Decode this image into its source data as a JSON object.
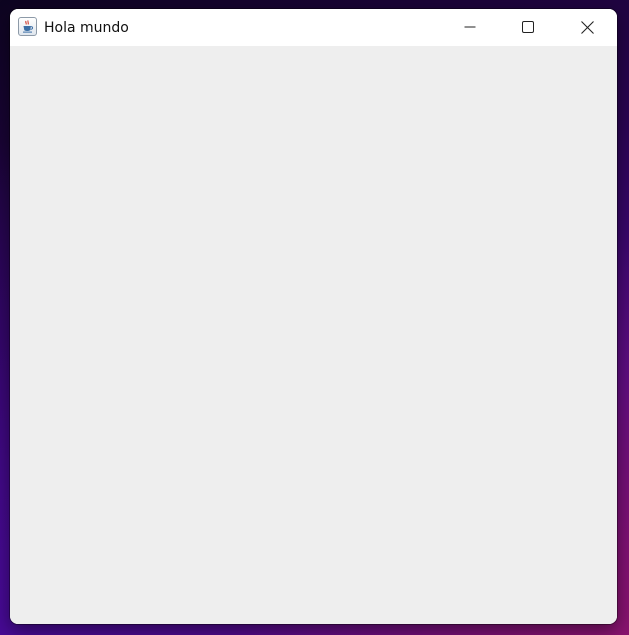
{
  "window": {
    "title": "Hola mundo",
    "icon": "java-cup-icon",
    "controls": {
      "minimize": "minimize-icon",
      "maximize": "maximize-icon",
      "close": "close-icon"
    }
  },
  "colors": {
    "titlebar": "#ffffff",
    "content_background": "#eeeeee",
    "title_text": "#111111"
  }
}
